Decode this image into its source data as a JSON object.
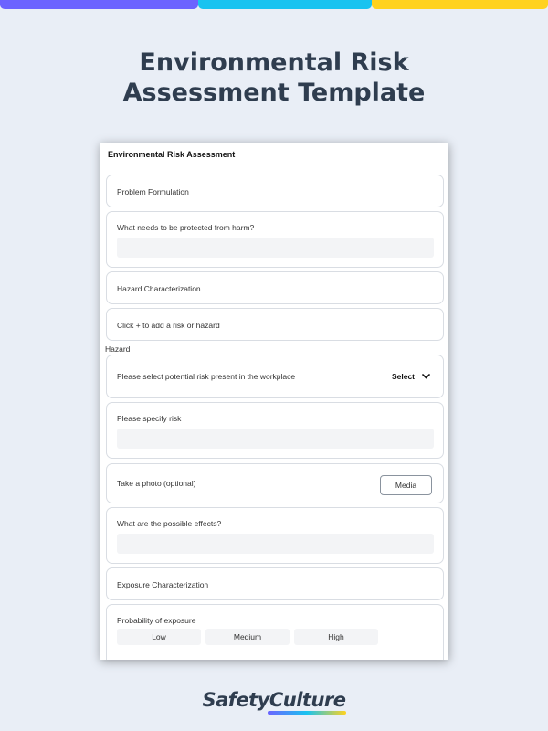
{
  "colors": {
    "bar1": "#6c63ff",
    "bar2": "#19c3f0",
    "bar3": "#ffd21f",
    "background": "#e9eef6",
    "title": "#2f3d4f"
  },
  "page": {
    "title_line1": "Environmental Risk",
    "title_line2": "Assessment Template"
  },
  "form": {
    "header": "Environmental Risk Assessment",
    "problem_formulation": "Problem Formulation",
    "protect_question": "What needs to be protected from harm?",
    "hazard_characterization": "Hazard Characterization",
    "add_risk": "Click + to add a risk or hazard",
    "hazard_label": "Hazard",
    "select_risk_question": "Please select potential risk present in the workplace",
    "select_value": "Select",
    "specify_risk": "Please specify risk",
    "photo_label": "Take a photo (optional)",
    "media_button": "Media",
    "effects_question": "What are the possible effects?",
    "exposure_characterization": "Exposure Characterization",
    "probability_label": "Probability of exposure",
    "probability_options": [
      "Low",
      "Medium",
      "High"
    ]
  },
  "logo": {
    "text": "SafetyCulture",
    "icon": "safetyculture-logo"
  }
}
